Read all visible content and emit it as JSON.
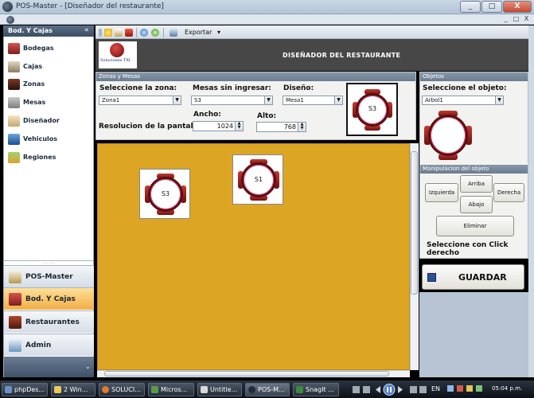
{
  "window": {
    "title": "POS-Master - [Diseñador del restaurante]",
    "controls": [
      "_",
      "□",
      "X"
    ],
    "mdi_controls": [
      "_",
      "□",
      "X"
    ]
  },
  "left_panel": {
    "header": "Bod. Y Cajas",
    "collapse": "«",
    "items": [
      {
        "label": "Bodegas",
        "icon": "warehouse-icon"
      },
      {
        "label": "Cajas",
        "icon": "cashbox-icon"
      },
      {
        "label": "Zonas",
        "icon": "zones-icon"
      },
      {
        "label": "Mesas",
        "icon": "tables-icon"
      },
      {
        "label": "Diseñador",
        "icon": "designer-icon"
      },
      {
        "label": "Vehiculos",
        "icon": "vehicles-icon"
      },
      {
        "label": "Regiones",
        "icon": "regions-icon"
      }
    ],
    "nav": [
      {
        "label": "POS-Master",
        "active": false
      },
      {
        "label": "Bod. Y Cajas",
        "active": true
      },
      {
        "label": "Restaurantes",
        "active": false
      },
      {
        "label": "Admin",
        "active": false
      }
    ],
    "bottom_chevron": "⌄"
  },
  "toolbar": {
    "export_label": "Exportar",
    "export_arrow": "▾"
  },
  "header": {
    "logo_text": "Soluciones TXI",
    "title": "DISEÑADOR DEL RESTAURANTE"
  },
  "zone_panel": {
    "title": "Zonas y Mesas",
    "zone_label": "Seleccione la zona:",
    "zone_value": "Zona1",
    "tables_label": "Mesas sin ingresar:",
    "tables_value": "S3",
    "design_label": "Diseño:",
    "design_value": "Mesa1",
    "resolution_label": "Resolucion de la pantalla:",
    "width_label": "Ancho:",
    "width_value": "1024",
    "height_label": "Alto:",
    "height_value": "768",
    "preview_label": "S3"
  },
  "canvas": {
    "tables": [
      {
        "label": "S3"
      },
      {
        "label": "S1"
      }
    ]
  },
  "objects_panel": {
    "title": "Objetos",
    "select_label": "Seleccione el objeto:",
    "select_value": "Arbol1",
    "manip_title": "Manipulacion  del objeto",
    "left": "Izquierda",
    "up": "Arriba",
    "right": "Derecha",
    "down": "Abajo",
    "delete": "Eliminar",
    "hint": "Seleccione con Click derecho",
    "save": "GUARDAR"
  },
  "taskbar": {
    "tasks": [
      "phpDes...",
      "2 Win...",
      "SOLUCI...",
      "Micros...",
      "Untitle...",
      "POS-M...",
      "SnagIt ..."
    ],
    "lang": "EN",
    "time": "05:04 p.m."
  },
  "colors": {
    "canvas": "#dca524",
    "header": "#474747",
    "active_nav": "#f2ae45",
    "table_ring": "#5d0e0e"
  }
}
